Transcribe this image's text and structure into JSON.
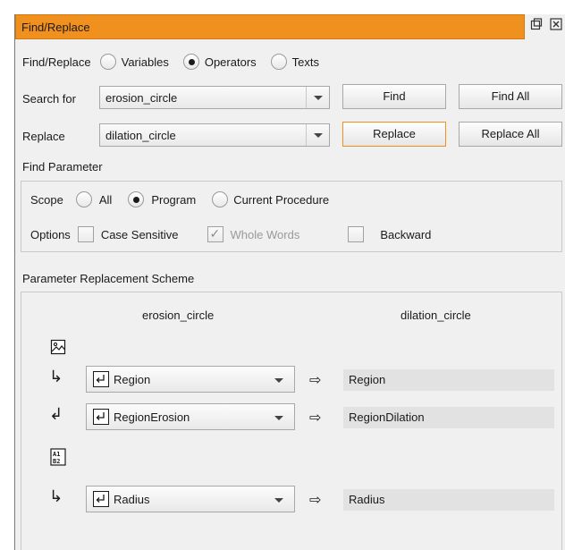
{
  "window": {
    "title": "Find/Replace",
    "float_icon": "float-icon",
    "close_icon": "close-icon"
  },
  "find_replace": {
    "label": "Find/Replace",
    "options": [
      {
        "label": "Variables",
        "selected": false
      },
      {
        "label": "Operators",
        "selected": true
      },
      {
        "label": "Texts",
        "selected": false
      }
    ]
  },
  "search": {
    "label": "Search for",
    "value": "erosion_circle",
    "find_label": "Find",
    "find_all_label": "Find All"
  },
  "replace": {
    "label": "Replace",
    "value": "dilation_circle",
    "replace_label": "Replace",
    "replace_all_label": "Replace All"
  },
  "find_parameter": {
    "title": "Find Parameter",
    "scope_label": "Scope",
    "scope_options": [
      {
        "label": "All",
        "selected": false
      },
      {
        "label": "Program",
        "selected": true
      },
      {
        "label": "Current Procedure",
        "selected": false
      }
    ],
    "options_label": "Options",
    "checkboxes": [
      {
        "label": "Case Sensitive",
        "checked": false,
        "enabled": true
      },
      {
        "label": "Whole Words",
        "checked": true,
        "enabled": false
      },
      {
        "label": "Backward",
        "checked": false,
        "enabled": true
      }
    ]
  },
  "scheme": {
    "title": "Parameter Replacement Scheme",
    "source_operator": "erosion_circle",
    "target_operator": "dilation_circle",
    "rows": [
      {
        "direction": "input",
        "source": "Region",
        "target": "Region"
      },
      {
        "direction": "output",
        "source": "RegionErosion",
        "target": "RegionDilation"
      },
      {
        "direction": "input",
        "source": "Radius",
        "target": "Radius"
      }
    ]
  },
  "colors": {
    "accent": "#f0901e",
    "panel": "#f0f0f0",
    "field": "#e2e2e2"
  }
}
